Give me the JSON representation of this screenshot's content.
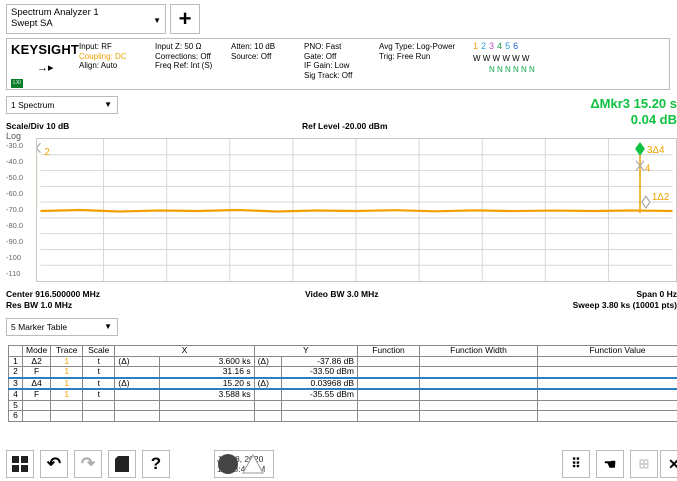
{
  "header": {
    "mode_line1": "Spectrum Analyzer 1",
    "mode_line2": "Swept SA",
    "add_label": "+"
  },
  "settings": {
    "brand": "KEYSIGHT",
    "input": "Input: RF",
    "coupling": "Coupling: DC",
    "align": "Align: Auto",
    "input_z": "Input Z: 50 Ω",
    "corrections": "Corrections: Off",
    "freq_ref": "Freq Ref: Int (S)",
    "atten": "Atten: 10 dB",
    "source": "Source: Off",
    "pno": "PNO: Fast",
    "gate": "Gate: Off",
    "if_gain": "IF Gain: Low",
    "sig_track": "Sig Track: Off",
    "avg_type": "Avg Type: Log-Power",
    "trig": "Trig: Free Run",
    "trace_numbers": [
      "1",
      "2",
      "3",
      "4",
      "5",
      "6"
    ],
    "trace_types": "W W W W W W",
    "trace_dets": "N N N N N N",
    "lxi": "LXI"
  },
  "window1": {
    "select_label": "1 Spectrum",
    "marker_line1": "ΔMkr3  15.20 s",
    "marker_line2": "0.04 dB",
    "scale_div": "Scale/Div 10 dB",
    "ref_level": "Ref Level -20.00 dBm",
    "log": "Log",
    "y_ticks": [
      "-30.0",
      "-40.0",
      "-50.0",
      "-60.0",
      "-70.0",
      "-80.0",
      "-90.0",
      "-100",
      "-110"
    ],
    "marker_labels": [
      "2",
      "3Δ4",
      "4",
      "1Δ2"
    ],
    "center": "Center 916.500000 MHz",
    "res_bw": "Res BW 1.0 MHz",
    "video_bw": "Video BW 3.0 MHz",
    "span": "Span 0 Hz",
    "sweep": "Sweep 3.80 ks (10001 pts)"
  },
  "window5": {
    "select_label": "5 Marker Table",
    "columns": [
      "",
      "Mode",
      "Trace",
      "Scale",
      "X",
      "",
      "Y",
      "Function",
      "Function Width",
      "Function Value"
    ],
    "rows": [
      {
        "n": "1",
        "mode": "Δ2",
        "trace": "1",
        "scale": "t",
        "xd": "(Δ)",
        "x": "3.600 ks",
        "yd": "(Δ)",
        "y": "-37.86 dB",
        "fn": "",
        "fw": "",
        "fv": ""
      },
      {
        "n": "2",
        "mode": "F",
        "trace": "1",
        "scale": "t",
        "xd": "",
        "x": "31.16 s",
        "yd": "",
        "y": "-33.50 dBm",
        "fn": "",
        "fw": "",
        "fv": ""
      },
      {
        "n": "3",
        "mode": "Δ4",
        "trace": "1",
        "scale": "t",
        "xd": "(Δ)",
        "x": "15.20 s",
        "yd": "(Δ)",
        "y": "0.03968 dB",
        "fn": "",
        "fw": "",
        "fv": ""
      },
      {
        "n": "4",
        "mode": "F",
        "trace": "1",
        "scale": "t",
        "xd": "",
        "x": "3.588 ks",
        "yd": "",
        "y": "-35.55 dBm",
        "fn": "",
        "fw": "",
        "fv": ""
      },
      {
        "n": "5",
        "mode": "",
        "trace": "",
        "scale": "",
        "xd": "",
        "x": "",
        "yd": "",
        "y": "",
        "fn": "",
        "fw": "",
        "fv": ""
      },
      {
        "n": "6",
        "mode": "",
        "trace": "",
        "scale": "",
        "xd": "",
        "x": "",
        "yd": "",
        "y": "",
        "fn": "",
        "fw": "",
        "fv": ""
      }
    ]
  },
  "taskbar": {
    "date": "Jul 08, 2020",
    "time": "12:08:40 PM",
    "help": "?"
  },
  "colors": {
    "trace": "#f0a000",
    "marker_active": "#10c040",
    "selection": "#2a7fc0"
  }
}
